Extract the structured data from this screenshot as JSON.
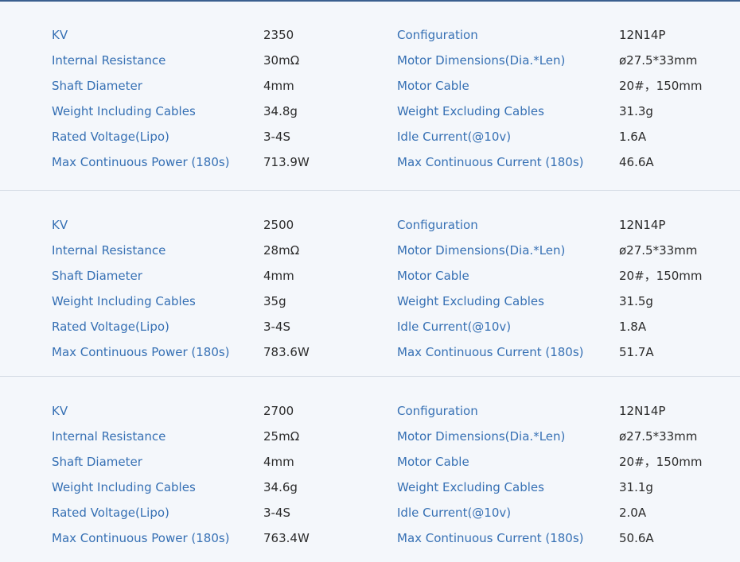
{
  "motors": [
    {
      "rows": [
        {
          "l1": "KV",
          "v1": "2350",
          "l2": "Configuration",
          "v2": "12N14P"
        },
        {
          "l1": "Internal Resistance",
          "v1": "30mΩ",
          "l2": "Motor Dimensions(Dia.*Len)",
          "v2": "ø27.5*33mm"
        },
        {
          "l1": "Shaft Diameter",
          "v1": "4mm",
          "l2": "Motor Cable",
          "v2": "20#，150mm"
        },
        {
          "l1": "Weight Including Cables",
          "v1": "34.8g",
          "l2": "Weight Excluding Cables",
          "v2": "31.3g"
        },
        {
          "l1": "Rated Voltage(Lipo)",
          "v1": "3-4S",
          "l2": "Idle Current(@10v)",
          "v2": "1.6A"
        },
        {
          "l1": "Max Continuous Power (180s)",
          "v1": "713.9W",
          "l2": "Max Continuous Current (180s)",
          "v2": "46.6A"
        }
      ]
    },
    {
      "rows": [
        {
          "l1": "KV",
          "v1": "2500",
          "l2": "Configuration",
          "v2": "12N14P"
        },
        {
          "l1": "Internal Resistance",
          "v1": "28mΩ",
          "l2": "Motor Dimensions(Dia.*Len)",
          "v2": "ø27.5*33mm"
        },
        {
          "l1": "Shaft Diameter",
          "v1": "4mm",
          "l2": "Motor Cable",
          "v2": "20#，150mm"
        },
        {
          "l1": "Weight Including Cables",
          "v1": "35g",
          "l2": "Weight Excluding Cables",
          "v2": "31.5g"
        },
        {
          "l1": "Rated Voltage(Lipo)",
          "v1": "3-4S",
          "l2": "Idle Current(@10v)",
          "v2": "1.8A"
        },
        {
          "l1": "Max Continuous Power (180s)",
          "v1": "783.6W",
          "l2": "Max Continuous Current (180s)",
          "v2": "51.7A"
        }
      ]
    },
    {
      "rows": [
        {
          "l1": "KV",
          "v1": "2700",
          "l2": "Configuration",
          "v2": "12N14P"
        },
        {
          "l1": "Internal Resistance",
          "v1": "25mΩ",
          "l2": "Motor Dimensions(Dia.*Len)",
          "v2": "ø27.5*33mm"
        },
        {
          "l1": "Shaft Diameter",
          "v1": "4mm",
          "l2": "Motor Cable",
          "v2": "20#，150mm"
        },
        {
          "l1": "Weight Including Cables",
          "v1": "34.6g",
          "l2": "Weight Excluding Cables",
          "v2": "31.1g"
        },
        {
          "l1": "Rated Voltage(Lipo)",
          "v1": "3-4S",
          "l2": "Idle Current(@10v)",
          "v2": "2.0A"
        },
        {
          "l1": "Max Continuous Power (180s)",
          "v1": "763.4W",
          "l2": "Max Continuous Current (180s)",
          "v2": "50.6A"
        }
      ]
    }
  ],
  "colors": {
    "background": "#f4f7fb",
    "label": "#3670b4",
    "value": "#2b2b2b",
    "divider": "#d7dde6",
    "top_rule": "#3a5f8f"
  }
}
